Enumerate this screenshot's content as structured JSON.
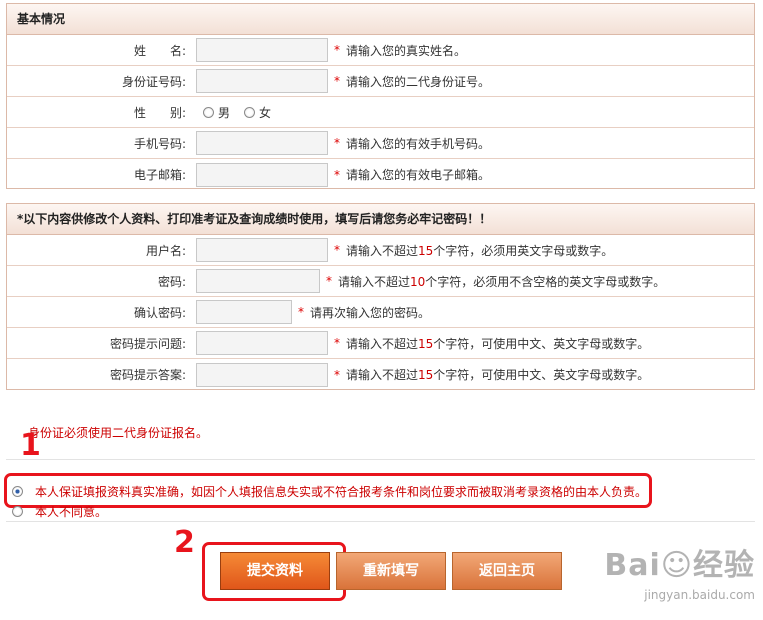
{
  "basic": {
    "title": "基本情况",
    "rows": [
      {
        "label": "姓　　名:",
        "hint_pre": "请输入您的真实姓名。"
      },
      {
        "label": "身份证号码:",
        "hint_pre": "请输入您的二代身份证号。"
      },
      {
        "label": "性　　别:",
        "male": "男",
        "female": "女"
      },
      {
        "label": "手机号码:",
        "hint_pre": "请输入您的有效手机号码。"
      },
      {
        "label": "电子邮箱:",
        "hint_pre": "请输入您的有效电子邮箱。"
      }
    ]
  },
  "account": {
    "title": "*以下内容供修改个人资料、打印准考证及查询成绩时使用，填写后请您务必牢记密码！！",
    "rows": [
      {
        "label": "用户名:",
        "hint_pre": "请输入不超过",
        "num": "15",
        "hint_post": "个字符，必须用英文字母或数字。"
      },
      {
        "label": "密码:",
        "hint_pre": "请输入不超过",
        "num": "10",
        "hint_post": "个字符，必须用不含空格的英文字母或数字。"
      },
      {
        "label": "确认密码:",
        "hint_pre": "请再次输入您的密码。"
      },
      {
        "label": "密码提示问题:",
        "hint_pre": "请输入不超过",
        "num": "15",
        "hint_post": "个字符，可使用中文、英文字母或数字。"
      },
      {
        "label": "密码提示答案:",
        "hint_pre": "请输入不超过",
        "num": "15",
        "hint_post": "个字符，可使用中文、英文字母或数字。"
      }
    ]
  },
  "required_mark": "*",
  "note": "身份证必须使用二代身份证报名。",
  "agree_text": "本人保证填报资料真实准确，如因个人填报信息失实或不符合报考条件和岗位要求而被取消考录资格的由本人负责。",
  "disagree_text": "本人不同意。",
  "annotations": {
    "mark1": "1",
    "mark2": "2"
  },
  "buttons": {
    "submit": "提交资料",
    "reset": "重新填写",
    "back": "返回主页"
  },
  "watermark": {
    "brand": "Bai☺经验",
    "url": "jingyan.baidu.com"
  },
  "colors": {
    "accent": "#e8141c",
    "button": "#e0561a",
    "required": "#dd0000"
  }
}
